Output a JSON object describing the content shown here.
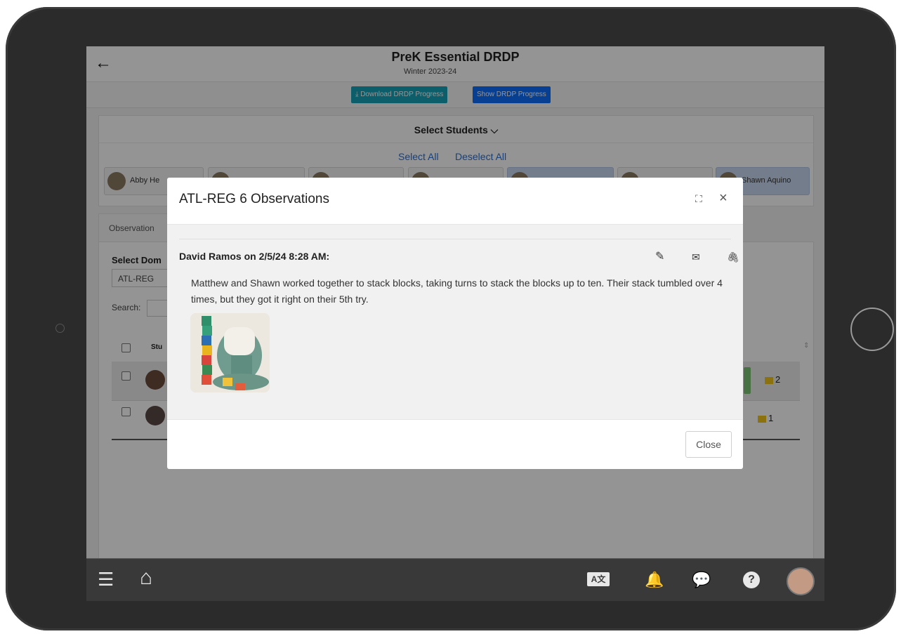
{
  "app": {
    "title": "PreK Essential DRDP",
    "subtitle": "Winter 2023-24",
    "back_icon": "←"
  },
  "toolbar": {
    "download_label": "⤓ Download DRDP Progress",
    "show_label": "Show DRDP Progress"
  },
  "students": {
    "heading": "Select Students ⌵",
    "select_all": "Select All",
    "deselect_all": "Deselect All",
    "chips": [
      {
        "name": "Abby He",
        "selected": false
      },
      {
        "name": "",
        "selected": false
      },
      {
        "name": "",
        "selected": false
      },
      {
        "name": "",
        "selected": false
      },
      {
        "name": "",
        "selected": true
      },
      {
        "name": "",
        "selected": false
      },
      {
        "name": "Shawn Aquino",
        "selected": true
      }
    ]
  },
  "main": {
    "tab": "Observation",
    "select_domain": "Select Dom",
    "domain_value": "ATL-REG",
    "search_label": "Search:",
    "column_student": "Stu",
    "rows": [
      {
        "count": "2"
      },
      {
        "count": "1"
      }
    ]
  },
  "nav": {
    "menu_icon": "☰",
    "home_icon": "⌂",
    "translate_icon": "A文",
    "bell_icon": "🔔",
    "chat_icon": "💬",
    "help_icon": "?"
  },
  "modal": {
    "title": "ATL-REG 6 Observations",
    "expand_icon": "⛶",
    "close_icon": "×",
    "author": "David Ramos on 2/5/24 8:28 AM:",
    "text": "Matthew and Shawn worked together to stack blocks, taking turns to stack the blocks up to ten. Their stack tumbled over 4 times, but they got it right on their 5th try.",
    "edit_icon": "✎",
    "mail_icon": "✉",
    "attach_icon": "🖇",
    "close_button": "Close"
  },
  "colors": {
    "download_btn": "#17a2b8",
    "show_btn": "#0d6efd",
    "link": "#2a6ed6",
    "navbar": "#393939"
  }
}
